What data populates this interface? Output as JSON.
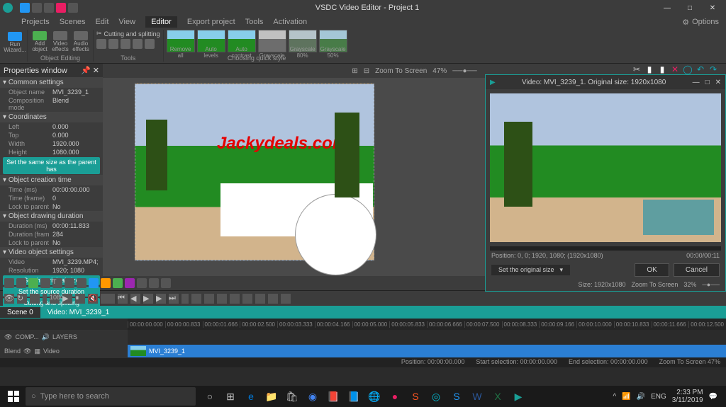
{
  "titlebar": {
    "title": "VSDC Video Editor - Project 1",
    "min": "—",
    "max": "□",
    "close": "✕"
  },
  "menubar": {
    "items": [
      "Projects",
      "Scenes",
      "Edit",
      "View",
      "Editor",
      "Export project",
      "Tools",
      "Activation"
    ],
    "selected": 4,
    "options": "Options"
  },
  "ribbon": {
    "run": {
      "label": "Run Wizard...",
      "group": ""
    },
    "editing": {
      "items": [
        "Add object",
        "Video effects",
        "Audio effects"
      ],
      "group": "Object Editing"
    },
    "tools": {
      "label": "Cutting and splitting",
      "group": "Tools"
    },
    "styles": {
      "items": [
        "Remove all",
        "Auto levels",
        "Auto contrast",
        "Grayscale",
        "Grayscale 80%",
        "Grayscale 50%"
      ],
      "group": "Choosing quick style"
    }
  },
  "canvas_toolbar": {
    "zoom_label": "Zoom To Screen",
    "zoom_value": "47%"
  },
  "properties": {
    "title": "Properties window",
    "sections": [
      {
        "name": "Common settings",
        "rows": [
          [
            "Object name",
            "MVI_3239_1"
          ],
          [
            "Composition mode",
            "Blend"
          ]
        ]
      },
      {
        "name": "Coordinates",
        "rows": [
          [
            "Left",
            "0.000"
          ],
          [
            "Top",
            "0.000"
          ],
          [
            "Width",
            "1920.000"
          ],
          [
            "Height",
            "1080.000"
          ]
        ],
        "btn": "Set the same size as the parent has"
      },
      {
        "name": "Object creation time",
        "rows": [
          [
            "Time (ms)",
            "00:00:00.000"
          ],
          [
            "Time (frame)",
            "0"
          ],
          [
            "Lock to parent",
            "No"
          ]
        ]
      },
      {
        "name": "Object drawing duration",
        "rows": [
          [
            "Duration (ms)",
            "00:00:11.833"
          ],
          [
            "Duration (fram",
            "284"
          ],
          [
            "Lock to parent",
            "No"
          ]
        ]
      },
      {
        "name": "Video object settings",
        "rows": [
          [
            "Video",
            "MVI_3239.MP4;"
          ],
          [
            "Resolution",
            "1920; 1080"
          ]
        ]
      }
    ],
    "buttons": [
      "Set the original size",
      "Set the source duration",
      "Cutting and splitting"
    ]
  },
  "watermark": "Jackydeals.com",
  "floatwin": {
    "title": "Video: MVI_3239_1. Original size: 1920x1080",
    "position": "Position:   0, 0; 1920, 1080; (1920x1080)",
    "duration": "00:00/00:11",
    "dropdown": "Set the original size",
    "ok": "OK",
    "cancel": "Cancel",
    "size": "Size:   1920x1080",
    "zoom_label": "Zoom To Screen",
    "zoom": "32%"
  },
  "timeline": {
    "fps": "1080p",
    "tabs": [
      "Scene 0",
      "Video: MVI_3239_1"
    ],
    "ruler": [
      "00:00:00.000",
      "00:00:00.833",
      "00:00:01.666",
      "00:00:02.500",
      "00:00:03.333",
      "00:00:04.166",
      "00:00:05.000",
      "00:00:05.833",
      "00:00:06.666",
      "00:00:07.500",
      "00:00:08.333",
      "00:00:09.166",
      "00:00:10.000",
      "00:00:10.833",
      "00:00:11.666",
      "00:00:12.500"
    ],
    "track1": {
      "header": "COMP...",
      "layers": "LAYERS"
    },
    "track2": {
      "header": "Blend",
      "sub": "Video",
      "clip": "MVI_3239_1"
    }
  },
  "statusbar": {
    "position": "Position:   00:00:00.000",
    "start": "Start selection:   00:00:00.000",
    "end": "End selection:   00:00:00.000",
    "zoom": "Zoom To Screen   47%"
  },
  "taskbar": {
    "search": "Type here to search",
    "lang": "ENG",
    "time": "2:33 PM",
    "date": "3/11/2019"
  }
}
